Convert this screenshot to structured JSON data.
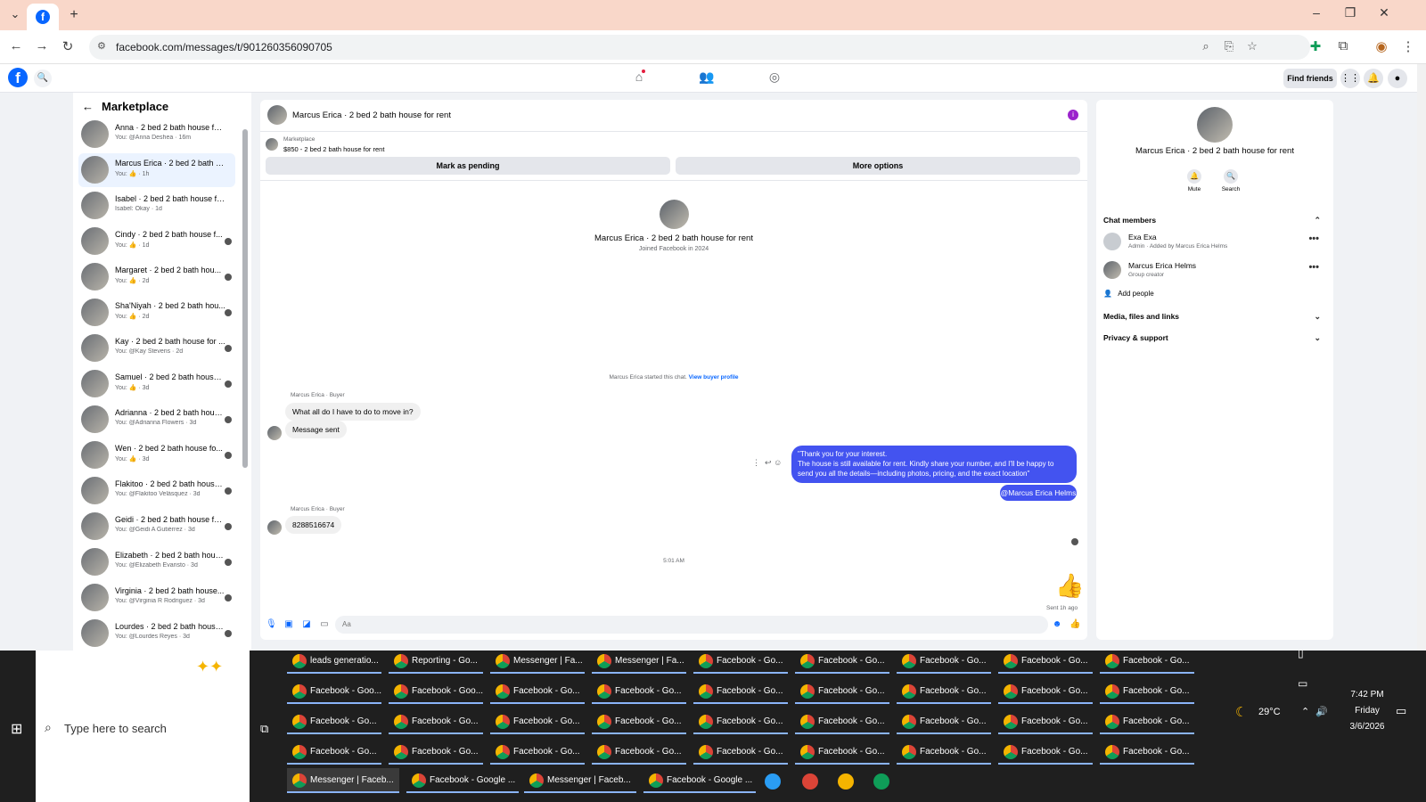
{
  "browser": {
    "url": "facebook.com/messages/t/901260356090705",
    "new_tab": "+",
    "tab_list": "⌄"
  },
  "fb": {
    "logo": "f",
    "find_friends": "Find friends"
  },
  "sidebar": {
    "title": "Marketplace",
    "conversations": [
      {
        "name": "Anna · 2 bed 2 bath house for r...",
        "sub": "You: @Anna Deshea · 16m"
      },
      {
        "name": "Marcus Erica · 2 bed 2 bath ho...",
        "sub": "You: 👍 · 1h"
      },
      {
        "name": "Isabel · 2 bed 2 bath house for ...",
        "sub": "Isabel: Okay · 1d"
      },
      {
        "name": "Cindy · 2 bed 2 bath house f...",
        "sub": "You: 👍 · 1d"
      },
      {
        "name": "Margaret · 2 bed 2 bath hou...",
        "sub": "You: 👍 · 2d"
      },
      {
        "name": "Sha'Niyah · 2 bed 2 bath hou...",
        "sub": "You: 👍 · 2d"
      },
      {
        "name": "Kay · 2 bed 2 bath house for ...",
        "sub": "You: @Kay Stevens · 2d"
      },
      {
        "name": "Samuel · 2 bed 2 bath house ...",
        "sub": "You: 👍 · 3d"
      },
      {
        "name": "Adrianna · 2 bed 2 bath house ...",
        "sub": "You: @Adrianna Flowers · 3d"
      },
      {
        "name": "Wen · 2 bed 2 bath house fo...",
        "sub": "You: 👍 · 3d"
      },
      {
        "name": "Flakitoo · 2 bed 2 bath house...",
        "sub": "You: @Flakitoo Velásquez · 3d"
      },
      {
        "name": "Geidi · 2 bed 2 bath house for r...",
        "sub": "You: @Geidi A Gutiérrez · 3d"
      },
      {
        "name": "Elizabeth · 2 bed 2 bath hous...",
        "sub": "You: @Elizabeth Evaristo · 3d"
      },
      {
        "name": "Virginia · 2 bed 2 bath house...",
        "sub": "You: @Virginia R Rodriguez · 3d"
      },
      {
        "name": "Lourdes · 2 bed 2 bath house f...",
        "sub": "You: @Lourdes Reyes · 3d"
      }
    ]
  },
  "chat": {
    "header_title": "Marcus Erica · 2 bed 2 bath house for rent",
    "listing_source": "Marketplace",
    "listing_desc": "$850 - 2 bed 2 bath house for rent",
    "mark_pending": "Mark as pending",
    "more_options": "More options",
    "profile_name": "Marcus Erica · 2 bed 2 bath house for rent",
    "joined": "Joined Facebook in 2024",
    "started": "Marcus Erica started this chat.",
    "view_buyer": "View buyer profile",
    "sender_label_1": "Marcus Erica · Buyer",
    "msg_1": "What all do I have to do to move in?",
    "msg_2": "Message sent",
    "out_line_1": "\"Thank you for your interest.",
    "out_line_2": "The house is still available for rent. Kindly share your number, and I'll be happy to",
    "out_line_3": "send you all the details—including photos, pricing, and the exact location\"",
    "out_mention": "@Marcus Erica Helms",
    "sender_label_2": "Marcus Erica · Buyer",
    "msg_3": "8288516674",
    "timestamp": "5:01 AM",
    "sent_status": "Sent 1h ago",
    "composer_placeholder": "Aa"
  },
  "rpanel": {
    "name": "Marcus Erica · 2 bed 2 bath house for rent",
    "mute": "Mute",
    "search": "Search",
    "chat_members": "Chat members",
    "members": [
      {
        "name": "Exa Exa",
        "role": "Admin · Added by Marcus Erica Helms"
      },
      {
        "name": "Marcus Erica Helms",
        "role": "Group creator"
      }
    ],
    "add_people": "Add people",
    "media": "Media, files and links",
    "privacy": "Privacy & support"
  },
  "taskbar": {
    "search_placeholder": "Type here to search",
    "rows": [
      [
        "leads generatio...",
        "Reporting - Go...",
        "Messenger | Fa...",
        "Messenger | Fa...",
        "Facebook - Go...",
        "Facebook - Go...",
        "Facebook - Go...",
        "Facebook - Go...",
        "Facebook - Go..."
      ],
      [
        "Facebook - Goo...",
        "Facebook - Goo...",
        "Facebook - Go...",
        "Facebook - Go...",
        "Facebook - Go...",
        "Facebook - Go...",
        "Facebook - Go...",
        "Facebook - Go...",
        "Facebook - Go..."
      ],
      [
        "Facebook - Go...",
        "Facebook - Go...",
        "Facebook - Go...",
        "Facebook - Go...",
        "Facebook - Go...",
        "Facebook - Go...",
        "Facebook - Go...",
        "Facebook - Go...",
        "Facebook - Go..."
      ],
      [
        "Facebook - Go...",
        "Facebook - Go...",
        "Facebook - Go...",
        "Facebook - Go...",
        "Facebook - Go...",
        "Facebook - Go...",
        "Facebook - Go...",
        "Facebook - Go...",
        "Facebook - Go..."
      ]
    ],
    "bottom_row": [
      "Messenger | Faceb...",
      "Facebook - Google ...",
      "Messenger | Faceb...",
      "Facebook - Google ..."
    ],
    "weather": "29°C",
    "time": "7:42 PM",
    "day": "Friday",
    "date": "3/6/2026"
  },
  "colors": {
    "accent": "#0866ff",
    "outgoing": "#4353f0",
    "tabbar": "#f9d7c9"
  }
}
